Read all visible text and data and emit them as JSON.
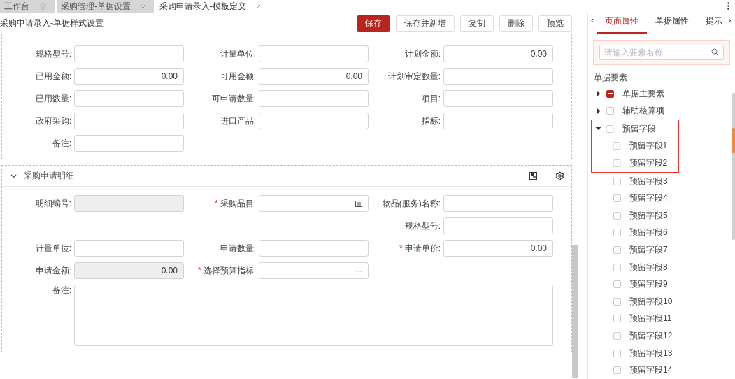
{
  "tabs": [
    {
      "label": "工作台",
      "selected": false
    },
    {
      "label": "采购管理-单据设置",
      "selected": false
    },
    {
      "label": "采购申请录入-模板定义",
      "selected": true
    }
  ],
  "toolbar": {
    "title": "采购申请录入-单据样式设置",
    "buttons": [
      {
        "label": "保存",
        "kind": "primary"
      },
      {
        "label": "保存并新增",
        "kind": "default"
      },
      {
        "label": "复制",
        "kind": "default"
      },
      {
        "label": "删除",
        "kind": "default"
      },
      {
        "label": "预览",
        "kind": "default"
      }
    ]
  },
  "sections": [
    {
      "rows": [
        [
          {
            "label": "规格型号:",
            "kind": "text"
          },
          {
            "label": "计量单位:",
            "kind": "text"
          },
          {
            "label": "计划金额:",
            "kind": "text",
            "value": "0.00"
          }
        ],
        [
          {
            "label": "已用金额:",
            "kind": "text",
            "value": "0.00"
          },
          {
            "label": "可用金额:",
            "kind": "text",
            "value": "0.00"
          },
          {
            "label": "计划审定数量:",
            "kind": "text"
          }
        ],
        [
          {
            "label": "已用数量:",
            "kind": "text"
          },
          {
            "label": "可申请数量:",
            "kind": "text"
          },
          {
            "label": "项目:",
            "kind": "text"
          }
        ],
        [
          {
            "label": "政府采购:",
            "kind": "text"
          },
          {
            "label": "进口产品:",
            "kind": "text"
          },
          {
            "label": "指标:",
            "kind": "text"
          }
        ],
        [
          {
            "label": "备注:",
            "kind": "text"
          }
        ]
      ]
    },
    {
      "title": "采购申请明细",
      "expanded": true,
      "rows": [
        [
          {
            "label": "明细编号:",
            "kind": "readonly"
          },
          {
            "label": "采购品目:",
            "kind": "picker",
            "required_mark": "*"
          },
          {
            "label": "物品(服务)名称:",
            "kind": "text"
          }
        ],
        [
          null,
          null,
          {
            "label": "规格型号:",
            "kind": "text"
          }
        ],
        [
          {
            "label": "计量单位:",
            "kind": "text"
          },
          {
            "label": "申请数量:",
            "kind": "text"
          },
          {
            "label": "申请单价:",
            "kind": "text",
            "value": "0.00",
            "required_mark": "*"
          }
        ],
        [
          {
            "label": "申请金额:",
            "kind": "readonly",
            "value": "0.00"
          },
          {
            "label": "选择预算指标:",
            "kind": "ellipsis",
            "suffix": "···",
            "required_mark": "*"
          }
        ],
        [
          {
            "label": "备注:",
            "kind": "textarea"
          }
        ]
      ]
    }
  ],
  "panel": {
    "scroll_left": "‹",
    "scroll_right": "›",
    "tabs": [
      {
        "label": "页面属性",
        "selected": true
      },
      {
        "label": "单据属性",
        "selected": false
      },
      {
        "label": "提示",
        "selected": false
      }
    ],
    "search": {
      "placeholder": "请输入要素名称"
    },
    "tree_title": "单据要素",
    "tree": [
      {
        "label": "单据主要素",
        "expanded": false,
        "indeterminate": true,
        "highlighted": false
      },
      {
        "label": "辅助核算项",
        "expanded": false,
        "checked": false,
        "highlighted": false
      },
      {
        "label": "预留字段",
        "expanded": true,
        "checked": false,
        "highlighted": true,
        "children": [
          {
            "label": "预留字段1",
            "checked": false,
            "highlighted": true
          },
          {
            "label": "预留字段2",
            "checked": false,
            "highlighted": true
          },
          {
            "label": "预留字段3",
            "checked": false,
            "highlighted": false
          },
          {
            "label": "预留字段4",
            "checked": false,
            "highlighted": false
          },
          {
            "label": "预留字段5",
            "checked": false,
            "highlighted": false
          },
          {
            "label": "预留字段6",
            "checked": false,
            "highlighted": false
          },
          {
            "label": "预留字段7",
            "checked": false,
            "highlighted": false
          },
          {
            "label": "预留字段8",
            "checked": false,
            "highlighted": false
          },
          {
            "label": "预留字段9",
            "checked": false,
            "highlighted": false
          },
          {
            "label": "预留字段10",
            "checked": false,
            "highlighted": false
          },
          {
            "label": "预留字段11",
            "checked": false,
            "highlighted": false
          },
          {
            "label": "预留字段12",
            "checked": false,
            "highlighted": false
          },
          {
            "label": "预留字段13",
            "checked": false,
            "highlighted": false
          },
          {
            "label": "预留字段14",
            "checked": false,
            "highlighted": false
          }
        ]
      }
    ]
  }
}
